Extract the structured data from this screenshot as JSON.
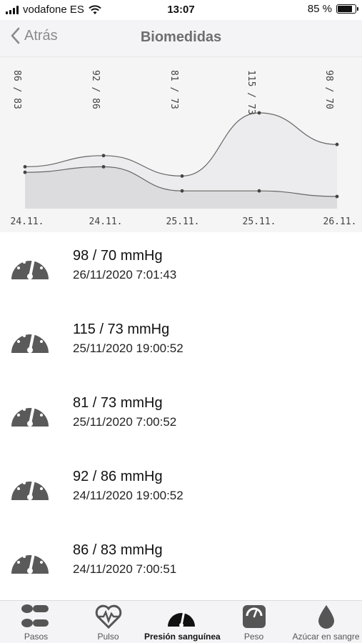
{
  "status_bar": {
    "carrier": "vodafone ES",
    "time": "13:07",
    "battery": "85 %",
    "battery_level": 0.85
  },
  "nav": {
    "back_label": "Atrás",
    "title": "Biomedidas"
  },
  "chart_data": {
    "type": "area",
    "categories": [
      "24.11.",
      "24.11.",
      "25.11.",
      "25.11.",
      "26.11."
    ],
    "value_labels": [
      "86 / 83",
      "92 / 86",
      "81 / 73",
      "115 / 73",
      "98 / 70"
    ],
    "series": [
      {
        "values": [
          86,
          92,
          81,
          115,
          98
        ]
      },
      {
        "values": [
          83,
          86,
          73,
          73,
          70
        ]
      }
    ],
    "colors": {
      "upper_fill": "#ececee",
      "lower_fill": "#dcdcde",
      "line": "#666666"
    }
  },
  "readings": [
    {
      "value": "98 / 70 mmHg",
      "date": "26/11/2020 7:01:43"
    },
    {
      "value": "115 / 73 mmHg",
      "date": "25/11/2020 19:00:52"
    },
    {
      "value": "81 / 73 mmHg",
      "date": "25/11/2020 7:00:52"
    },
    {
      "value": "92 / 86 mmHg",
      "date": "24/11/2020 19:00:52"
    },
    {
      "value": "86 / 83 mmHg",
      "date": "24/11/2020 7:00:51"
    }
  ],
  "tabs": [
    {
      "label": "Pasos",
      "icon": "footprints-icon"
    },
    {
      "label": "Pulso",
      "icon": "heart-pulse-icon"
    },
    {
      "label": "Presión sanguínea",
      "icon": "gauge-icon",
      "active": true
    },
    {
      "label": "Peso",
      "icon": "scale-icon"
    },
    {
      "label": "Azúcar en sangre",
      "icon": "drop-icon"
    }
  ]
}
